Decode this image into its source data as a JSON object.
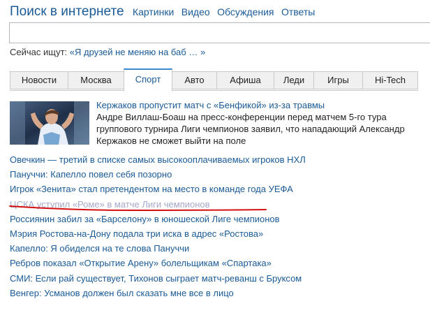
{
  "search": {
    "title": "Поиск в интернете",
    "verticals": [
      "Картинки",
      "Видео",
      "Обсуждения",
      "Ответы"
    ],
    "query": "",
    "trending_prefix": "Сейчас ищут:",
    "trending_query": "«Я друзей не меняю на баб … »"
  },
  "tabs": [
    "Новости",
    "Москва",
    "Спорт",
    "Авто",
    "Афиша",
    "Леди",
    "Игры",
    "Hi-Tech"
  ],
  "active_tab": "Спорт",
  "featured": {
    "title": "Кержаков пропустит матч с «Бенфикой» из-за травмы",
    "text": "Андре Виллаш-Боаш на пресс-конференции перед матчем 5-го тура группового турнира Лиги чемпионов заявил, что нападающий Александр Кержаков не сможет выйти на поле"
  },
  "news": [
    "Овечкин — третий в списке самых высокооплачиваемых игроков НХЛ",
    "Пануччи: Капелло повел себя позорно",
    "Игрок «Зенита» стал претендентом на место в команде года УЕФА",
    "ЦСКА уступил «Роме» в матче Лиги чемпионов",
    "Россиянин забил за «Барселону» в юношеской Лиге чемпионов",
    "Мэрия Ростова-на-Дону подала три иска в адрес «Ростова»",
    "Капелло: Я обиделся на те слова Пануччи",
    "Ребров показал «Открытие Арену» болельщикам «Спартака»",
    "СМИ: Если рай существует, Тихонов сыграет матч-реванш с Бруксом",
    "Венгер: Усманов должен был сказать мне все в лицо"
  ],
  "colors": {
    "link": "#1a5a96",
    "visited_link": "#a3a8c8",
    "annotation_underline": "#d41010",
    "active_tab_border": "#3a8ad0"
  }
}
